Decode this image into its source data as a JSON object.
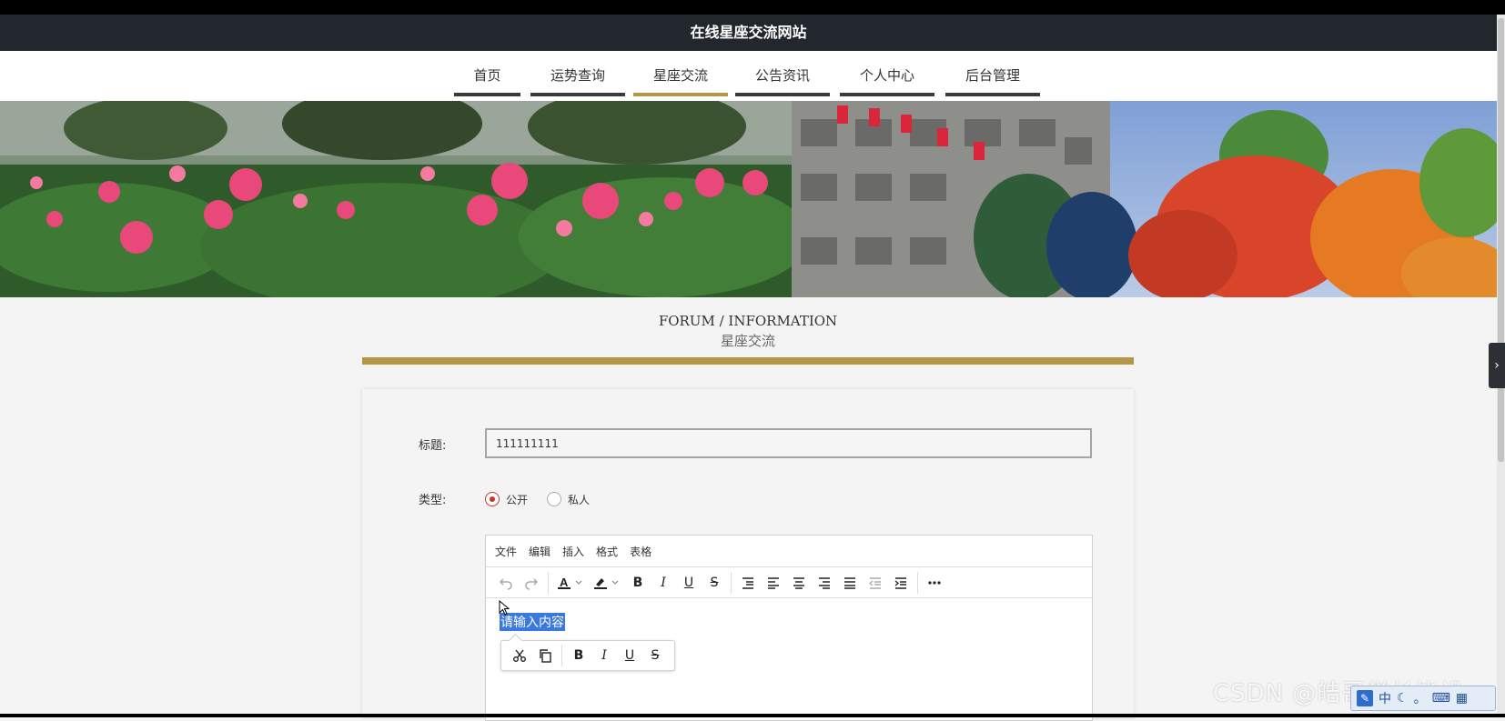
{
  "site_title": "在线星座交流网站",
  "nav": {
    "items": [
      {
        "label": "首页",
        "active": false
      },
      {
        "label": "运势查询",
        "active": false
      },
      {
        "label": "星座交流",
        "active": true
      },
      {
        "label": "公告资讯",
        "active": false
      },
      {
        "label": "个人中心",
        "active": false
      },
      {
        "label": "后台管理",
        "active": false
      }
    ]
  },
  "section": {
    "title_en": "FORUM / INFORMATION",
    "title_cn": "星座交流"
  },
  "form": {
    "title_label": "标题:",
    "title_value": "111111111",
    "type_label": "类型:",
    "type_options": [
      {
        "label": "公开",
        "checked": true
      },
      {
        "label": "私人",
        "checked": false
      }
    ]
  },
  "editor": {
    "menu": [
      "文件",
      "编辑",
      "插入",
      "格式",
      "表格"
    ],
    "placeholder": "请输入内容",
    "toolbar_icons": [
      "undo-icon",
      "redo-icon",
      "text-color-icon",
      "highlight-icon",
      "bold-icon",
      "italic-icon",
      "underline-icon",
      "strikethrough-icon",
      "line-height-icon",
      "align-left-icon",
      "align-center-icon",
      "align-right-icon",
      "align-justify-icon",
      "outdent-icon",
      "indent-icon",
      "more-icon"
    ],
    "quick_toolbar_icons": [
      "cut-icon",
      "copy-icon",
      "bold-icon",
      "italic-icon",
      "underline-icon",
      "strikethrough-icon"
    ]
  },
  "watermark": "CSDN @皓哥学长毕设",
  "ime": {
    "label": "中"
  },
  "colors": {
    "header_bg": "#22262d",
    "accent_gold": "#b49649",
    "radio_red": "#c0392b",
    "selection_blue": "#3b78e0"
  }
}
